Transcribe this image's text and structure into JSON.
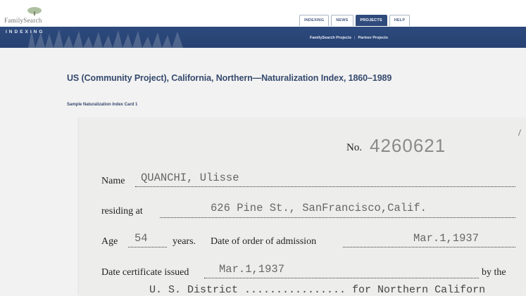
{
  "logo": {
    "text": "FamilySearch",
    "subtitle": "INDEXING"
  },
  "tabs": [
    {
      "label": "INDEXING",
      "active": false
    },
    {
      "label": "NEWS",
      "active": false
    },
    {
      "label": "PROJECTS",
      "active": true
    },
    {
      "label": "HELP",
      "active": false
    }
  ],
  "subnav": {
    "familysearch_projects": "FamilySearch Projects",
    "partner_projects": "Partner Projects",
    "separator": "|"
  },
  "page": {
    "title": "US (Community Project), California, Northern—Naturalization Index, 1860–1989",
    "card_caption": "Sample Naturalization Index Card 1"
  },
  "card": {
    "mark": "/",
    "number_label": "No.",
    "number_value": "4260621",
    "name_label": "Name",
    "name_value": "QUANCHI, Ulisse",
    "residing_label": "residing at",
    "residing_value": "626 Pine St., SanFrancisco,Calif.",
    "age_label": "Age",
    "age_value": "54",
    "years_label": "years.",
    "order_label": "Date of order of admission",
    "order_value": "Mar.1,1937",
    "cert_label": "Date certificate issued",
    "cert_value": "Mar.1,1937",
    "by_label": "by the",
    "next_line": "U. S. District ................ for Northern Californ"
  },
  "colors": {
    "banner": "#2d4a7e",
    "title": "#364a6e",
    "active_tab": "#2f4b7c",
    "card": "#ededeb"
  }
}
